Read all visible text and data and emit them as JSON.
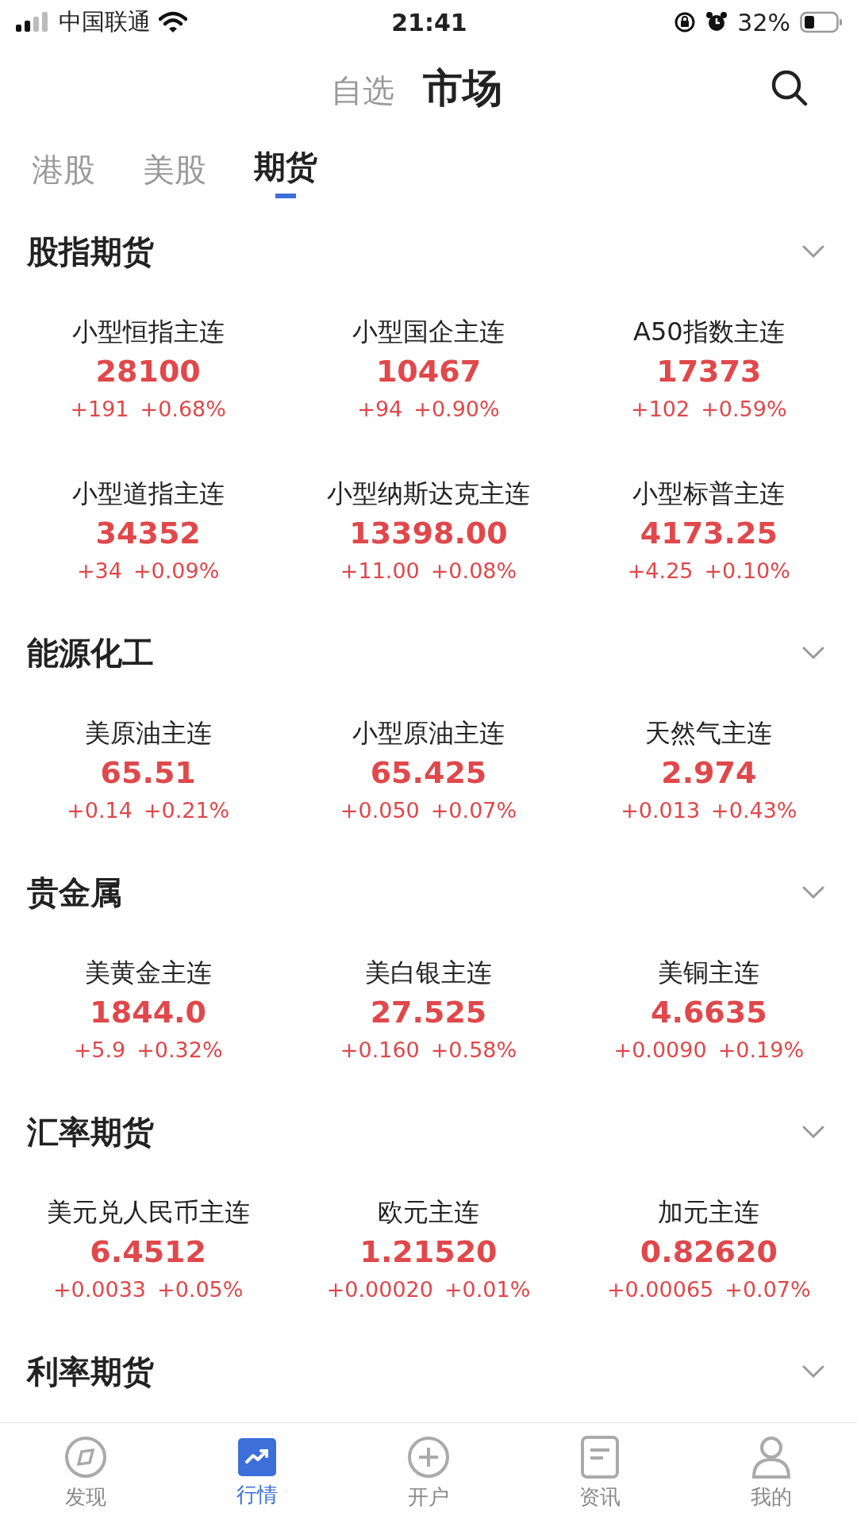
{
  "status_bar": {
    "carrier": "中国联通",
    "time": "21:41",
    "battery": "32%"
  },
  "header": {
    "tabs": [
      {
        "label": "自选",
        "selected": false
      },
      {
        "label": "市场",
        "selected": true
      }
    ]
  },
  "market_tabs": [
    {
      "label": "港股",
      "selected": false
    },
    {
      "label": "美股",
      "selected": false
    },
    {
      "label": "期货",
      "selected": true
    }
  ],
  "sections": [
    {
      "title": "股指期货",
      "expanded": true,
      "items": [
        {
          "name": "小型恒指主连",
          "price": "28100",
          "change": "+191",
          "percent": "+0.68%"
        },
        {
          "name": "小型国企主连",
          "price": "10467",
          "change": "+94",
          "percent": "+0.90%"
        },
        {
          "name": "A50指数主连",
          "price": "17373",
          "change": "+102",
          "percent": "+0.59%"
        },
        {
          "name": "小型道指主连",
          "price": "34352",
          "change": "+34",
          "percent": "+0.09%"
        },
        {
          "name": "小型纳斯达克主连",
          "price": "13398.00",
          "change": "+11.00",
          "percent": "+0.08%"
        },
        {
          "name": "小型标普主连",
          "price": "4173.25",
          "change": "+4.25",
          "percent": "+0.10%"
        }
      ]
    },
    {
      "title": "能源化工",
      "expanded": true,
      "items": [
        {
          "name": "美原油主连",
          "price": "65.51",
          "change": "+0.14",
          "percent": "+0.21%"
        },
        {
          "name": "小型原油主连",
          "price": "65.425",
          "change": "+0.050",
          "percent": "+0.07%"
        },
        {
          "name": "天然气主连",
          "price": "2.974",
          "change": "+0.013",
          "percent": "+0.43%"
        }
      ]
    },
    {
      "title": "贵金属",
      "expanded": true,
      "items": [
        {
          "name": "美黄金主连",
          "price": "1844.0",
          "change": "+5.9",
          "percent": "+0.32%"
        },
        {
          "name": "美白银主连",
          "price": "27.525",
          "change": "+0.160",
          "percent": "+0.58%"
        },
        {
          "name": "美铜主连",
          "price": "4.6635",
          "change": "+0.0090",
          "percent": "+0.19%"
        }
      ]
    },
    {
      "title": "汇率期货",
      "expanded": true,
      "items": [
        {
          "name": "美元兑人民币主连",
          "price": "6.4512",
          "change": "+0.0033",
          "percent": "+0.05%"
        },
        {
          "name": "欧元主连",
          "price": "1.21520",
          "change": "+0.00020",
          "percent": "+0.01%"
        },
        {
          "name": "加元主连",
          "price": "0.82620",
          "change": "+0.00065",
          "percent": "+0.07%"
        }
      ]
    },
    {
      "title": "利率期货",
      "expanded": true
    }
  ],
  "bottom_nav": [
    {
      "kind": "compass",
      "label": "发现",
      "selected": false
    },
    {
      "kind": "chart",
      "label": "行情",
      "selected": true
    },
    {
      "kind": "plus",
      "label": "开户",
      "selected": false
    },
    {
      "kind": "news",
      "label": "资讯",
      "selected": false
    },
    {
      "kind": "person",
      "label": "我的",
      "selected": false
    }
  ]
}
